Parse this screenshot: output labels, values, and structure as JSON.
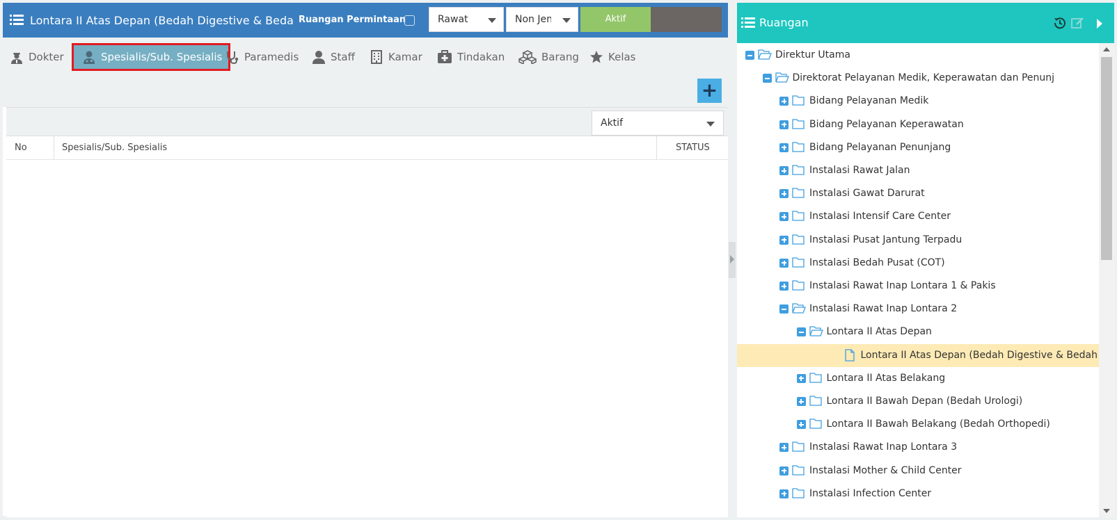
{
  "colors": {
    "header_blue": "#3a7ebf",
    "teal_header": "#1ec6bf",
    "aktif_green": "#93c569",
    "active_tab_bg": "#76afc3",
    "highlight_border": "#e11b22",
    "selected_row": "#fdeab5",
    "tree_toggle": "#3f9ee0"
  },
  "header": {
    "list_icon": "list-icon",
    "title": "Lontara II Atas Depan (Bedah Digestive & Bedah Pla",
    "ruangan_permintaan_label": "Ruangan Permintaan",
    "ruangan_permintaan_checked": false,
    "rawat_select": "Rawat",
    "jenis_select": "Non Jenis",
    "aktif_button": "Aktif"
  },
  "tabs": [
    {
      "label": "Dokter",
      "icon": "doctor-icon",
      "active": false
    },
    {
      "label": "Spesialis/Sub. Spesialis",
      "icon": "user-md-icon",
      "active": true
    },
    {
      "label": "Paramedis",
      "icon": "stethoscope-icon",
      "active": false
    },
    {
      "label": "Staff",
      "icon": "user-icon",
      "active": false
    },
    {
      "label": "Kamar",
      "icon": "building-icon",
      "active": false
    },
    {
      "label": "Tindakan",
      "icon": "medkit-icon",
      "active": false
    },
    {
      "label": "Barang",
      "icon": "cubes-icon",
      "active": false
    },
    {
      "label": "Kelas",
      "icon": "star-icon",
      "active": false
    }
  ],
  "add_button": "+",
  "status_filter": "Aktif",
  "table": {
    "columns": [
      "No",
      "Spesialis/Sub. Spesialis",
      "STATUS"
    ],
    "rows": []
  },
  "ruangan": {
    "title": "Ruangan",
    "tree": [
      {
        "label": "Direktur Utama",
        "state": "minus",
        "folder": "open"
      },
      {
        "label": "Direktorat Pelayanan Medik, Keperawatan dan Penunj",
        "state": "minus",
        "folder": "open"
      },
      {
        "label": "Bidang Pelayanan Medik",
        "state": "plus",
        "folder": "closed"
      },
      {
        "label": "Bidang Pelayanan Keperawatan",
        "state": "plus",
        "folder": "closed"
      },
      {
        "label": "Bidang Pelayanan Penunjang",
        "state": "plus",
        "folder": "closed"
      },
      {
        "label": "Instalasi Rawat Jalan",
        "state": "plus",
        "folder": "closed"
      },
      {
        "label": "Instalasi Gawat Darurat",
        "state": "plus",
        "folder": "closed"
      },
      {
        "label": "Instalasi Intensif Care Center",
        "state": "plus",
        "folder": "closed"
      },
      {
        "label": "Instalasi Pusat Jantung Terpadu",
        "state": "plus",
        "folder": "closed"
      },
      {
        "label": "Instalasi Bedah Pusat (COT)",
        "state": "plus",
        "folder": "closed"
      },
      {
        "label": "Instalasi Rawat Inap Lontara 1 & Pakis",
        "state": "plus",
        "folder": "closed"
      },
      {
        "label": "Instalasi Rawat Inap Lontara 2",
        "state": "minus",
        "folder": "open"
      },
      {
        "label": "Lontara II Atas Depan",
        "state": "minus",
        "folder": "open"
      },
      {
        "label": "Lontara II Atas Depan (Bedah Digestive & Bedah Pla",
        "state": "leaf",
        "folder": "file",
        "selected": true
      },
      {
        "label": "Lontara II Atas Belakang",
        "state": "plus",
        "folder": "closed"
      },
      {
        "label": "Lontara II Bawah Depan (Bedah Urologi)",
        "state": "plus",
        "folder": "closed"
      },
      {
        "label": "Lontara II Bawah Belakang (Bedah Orthopedi)",
        "state": "plus",
        "folder": "closed"
      },
      {
        "label": "Instalasi Rawat Inap Lontara 3",
        "state": "plus",
        "folder": "closed"
      },
      {
        "label": "Instalasi Mother & Child Center",
        "state": "plus",
        "folder": "closed"
      },
      {
        "label": "Instalasi Infection Center",
        "state": "plus",
        "folder": "closed"
      }
    ]
  }
}
